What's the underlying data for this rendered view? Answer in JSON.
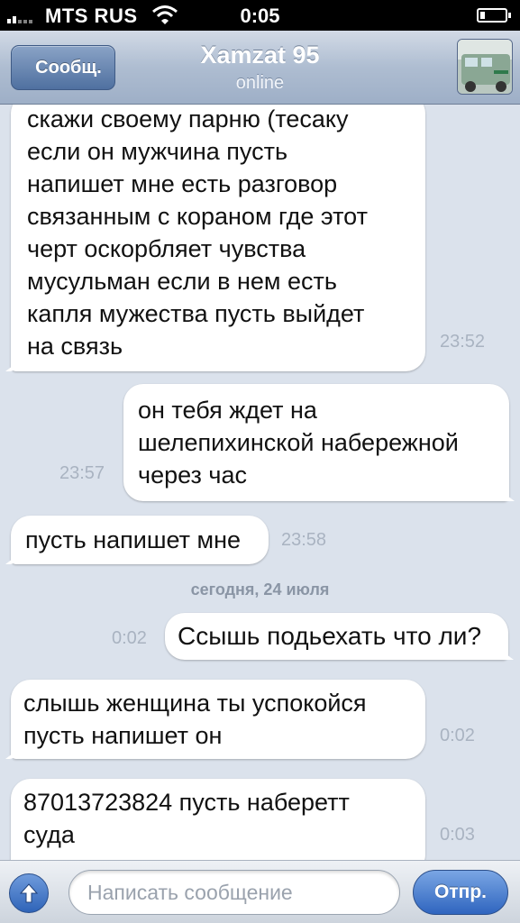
{
  "status_bar": {
    "carrier": "MTS RUS",
    "time": "0:05",
    "signal_icon": "signal-bars-icon",
    "wifi_icon": "wifi-icon",
    "battery_icon": "battery-icon"
  },
  "nav": {
    "back_label": "Сообщ.",
    "contact_name": "Xamzat 95",
    "contact_status": "online",
    "avatar_icon": "contact-avatar"
  },
  "messages": [
    {
      "dir": "in",
      "text": "скажи своему парню (тесаку\nесли он мужчина пусть\nнапишет мне есть разговор\nсвязанным с кораном где этот\nчерт оскорбляет чувства\nмусульман если в нем есть\nкапля мужества пусть выйдет\nна связь",
      "time": "23:52"
    },
    {
      "dir": "out",
      "text": "он тебя ждет на\nшелепихинской набережной\nчерез час",
      "time": "23:57"
    },
    {
      "dir": "in",
      "text": "пусть напишет мне",
      "time": "23:58"
    },
    {
      "dir": "out",
      "text": "Ссышь подьехать что ли?",
      "time": "0:02"
    },
    {
      "dir": "in",
      "text": "слышь женщина ты успокойся\nпусть напишет он",
      "time": "0:02"
    },
    {
      "dir": "in",
      "text": "87013723824 пусть наберетт\nсуда",
      "time": "0:03"
    }
  ],
  "date_separator": "сегодня, 24 июля",
  "input_bar": {
    "attach_icon": "up-arrow-icon",
    "placeholder": "Написать сообщение",
    "value": "",
    "send_label": "Отпр.",
    "colors": {
      "accent": "#2f65bf"
    }
  }
}
